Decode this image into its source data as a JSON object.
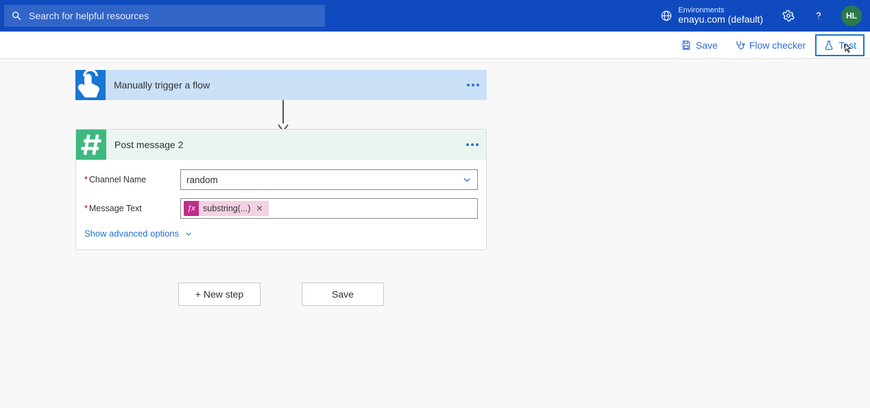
{
  "header": {
    "search_placeholder": "Search for helpful resources",
    "environments_label": "Environments",
    "environment_value": "enayu.com (default)",
    "avatar_initials": "HL"
  },
  "commandbar": {
    "save": "Save",
    "flow_checker": "Flow checker",
    "test": "Test"
  },
  "trigger": {
    "title": "Manually trigger a flow"
  },
  "action": {
    "title": "Post message 2",
    "fields": {
      "channel_name_label": "Channel Name",
      "channel_name_value": "random",
      "message_text_label": "Message Text",
      "message_token": "substring(...)"
    },
    "advanced_toggle": "Show advanced options"
  },
  "buttons": {
    "new_step": "+ New step",
    "save": "Save"
  }
}
